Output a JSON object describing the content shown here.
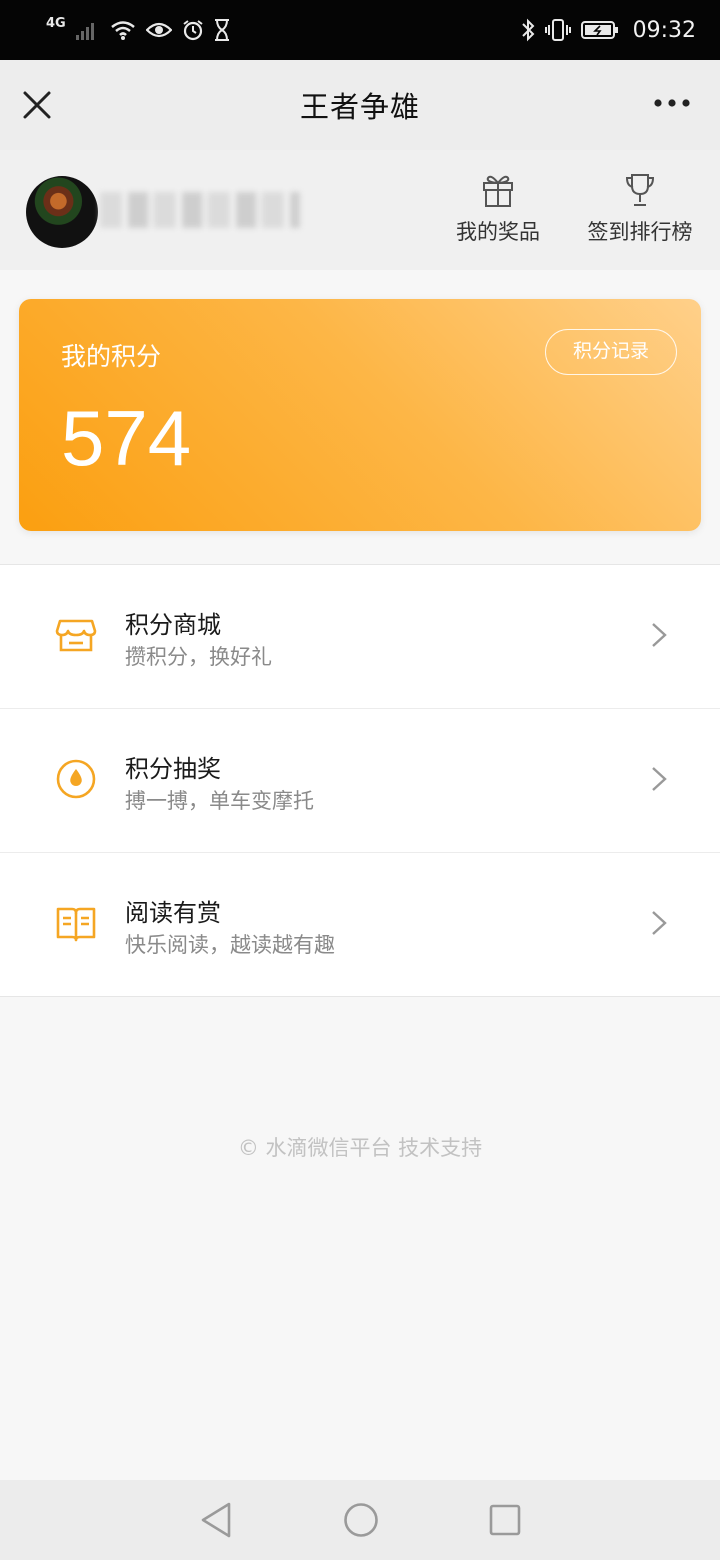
{
  "status_bar": {
    "network": "4G",
    "time": "09:32"
  },
  "header": {
    "title": "王者争雄"
  },
  "profile": {
    "actions": [
      {
        "label": "我的奖品",
        "icon": "gift-icon"
      },
      {
        "label": "签到排行榜",
        "icon": "trophy-icon"
      }
    ]
  },
  "points": {
    "label": "我的积分",
    "value": "574",
    "record_label": "积分记录"
  },
  "menu": [
    {
      "title": "积分商城",
      "subtitle": "攒积分，换好礼",
      "icon": "store-icon"
    },
    {
      "title": "积分抽奖",
      "subtitle": "搏一搏，单车变摩托",
      "icon": "lottery-icon"
    },
    {
      "title": "阅读有赏",
      "subtitle": "快乐阅读，越读越有趣",
      "icon": "book-icon"
    }
  ],
  "footer": {
    "text": "© 水滴微信平台 技术支持"
  },
  "colors": {
    "accent": "#f5a623",
    "card_gradient_start": "#fb9f10",
    "card_gradient_end": "#ffd08a"
  }
}
